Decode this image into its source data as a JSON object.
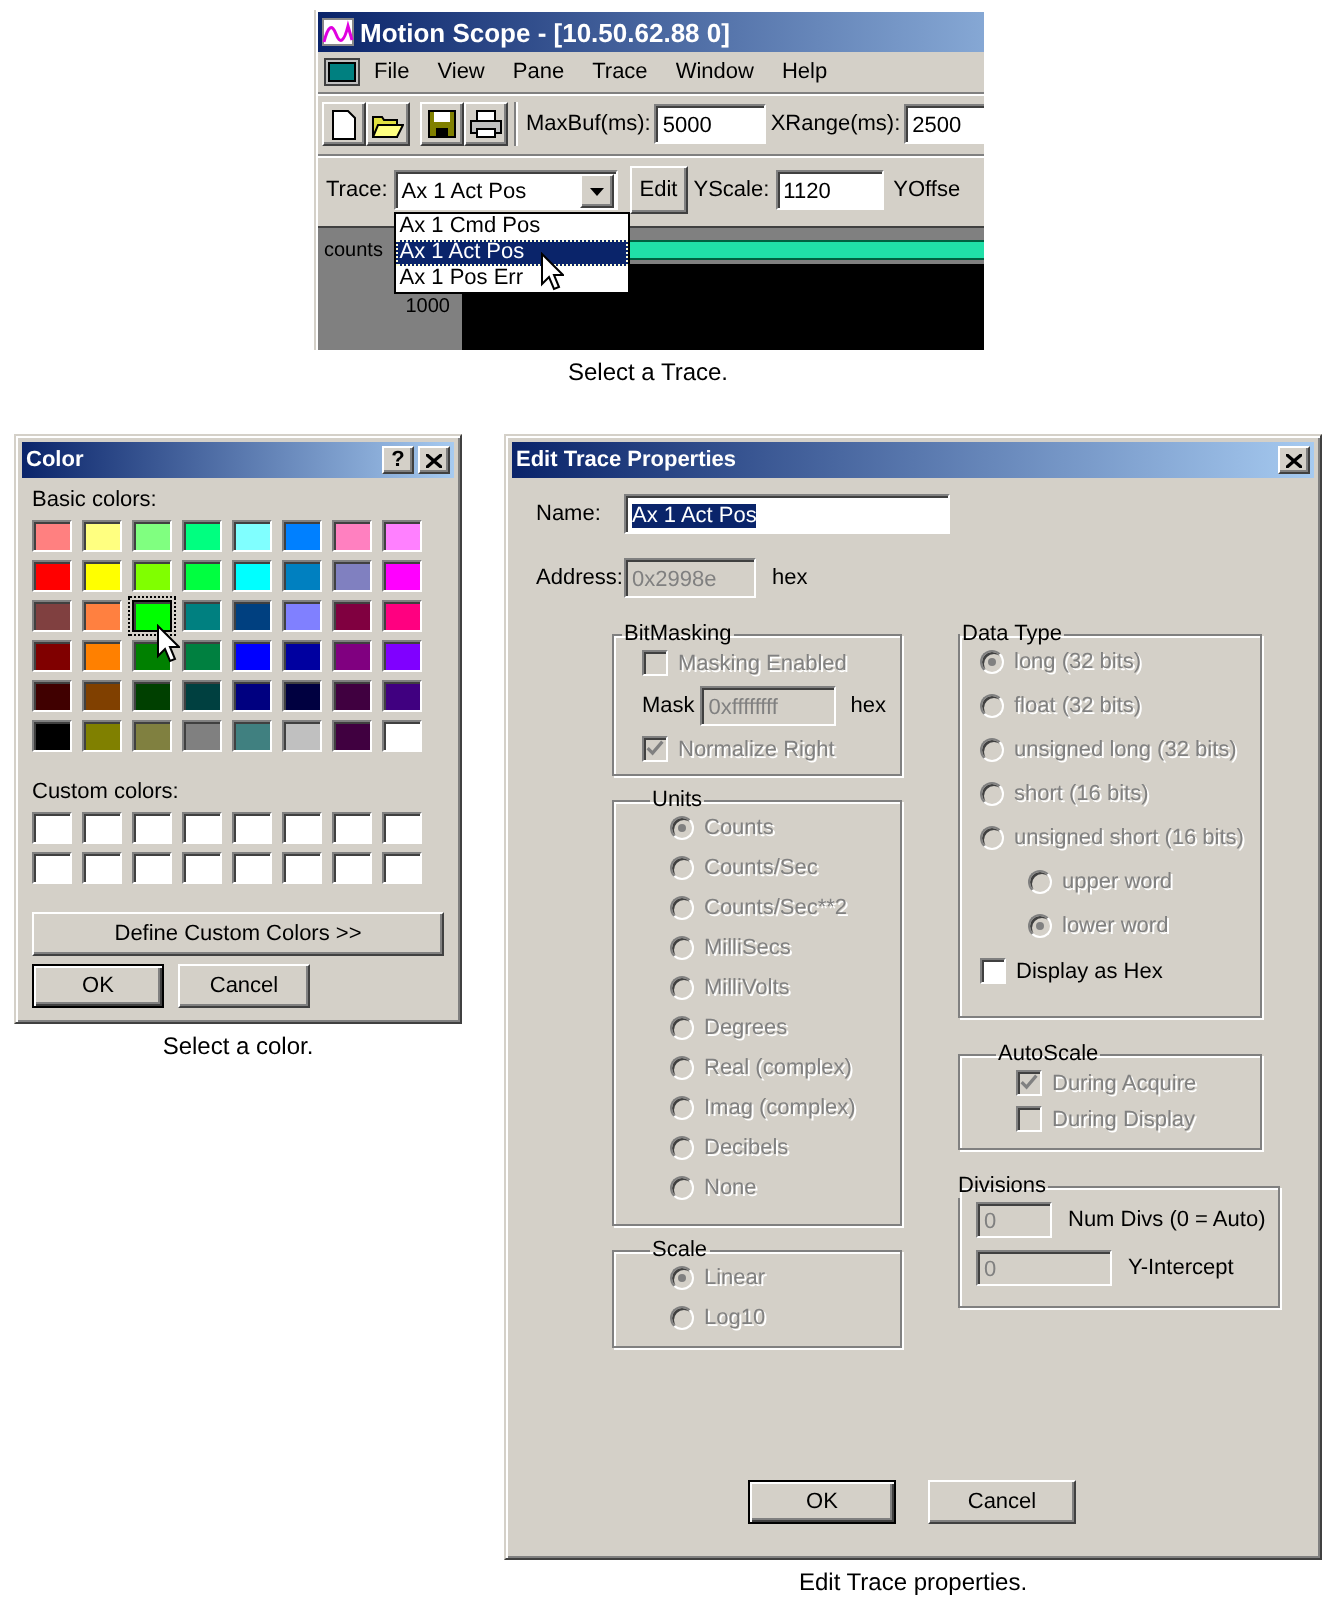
{
  "scope_window": {
    "title": "Motion Scope - [10.50.62.88 0]",
    "menu": [
      "File",
      "View",
      "Pane",
      "Trace",
      "Window",
      "Help"
    ],
    "toolbar_fields": [
      {
        "label": "MaxBuf(ms):",
        "value": "5000"
      },
      {
        "label": "XRange(ms):",
        "value": "2500"
      }
    ],
    "trace_label": "Trace:",
    "trace_value": "Ax 1 Act Pos",
    "expanded": true,
    "trace_options": [
      {
        "label": "Ax 1 Cmd Pos",
        "selected": false
      },
      {
        "label": "Ax 1 Act Pos",
        "selected": true
      },
      {
        "label": "Ax 1 Pos Err",
        "selected": false
      }
    ],
    "edit_button": "Edit",
    "yscale_label": "YScale:",
    "yscale_value": "1120",
    "yoffset_label": "YOffse",
    "plot": {
      "y_label": "counts",
      "y_tick": "1000"
    },
    "caption": "Select a Trace."
  },
  "color_dialog": {
    "title": "Color",
    "help_button": "?",
    "basic_label": "Basic colors:",
    "basic_colors": [
      {
        "color": "#ff8080",
        "selected": false
      },
      {
        "color": "#ffff80",
        "selected": false
      },
      {
        "color": "#80ff80",
        "selected": false
      },
      {
        "color": "#00ff80",
        "selected": false
      },
      {
        "color": "#80ffff",
        "selected": false
      },
      {
        "color": "#0080ff",
        "selected": false
      },
      {
        "color": "#ff80c0",
        "selected": false
      },
      {
        "color": "#ff80ff",
        "selected": false
      },
      {
        "color": "#ff0000",
        "selected": false
      },
      {
        "color": "#ffff00",
        "selected": false
      },
      {
        "color": "#80ff00",
        "selected": false
      },
      {
        "color": "#00ff40",
        "selected": false
      },
      {
        "color": "#00ffff",
        "selected": false
      },
      {
        "color": "#0080c0",
        "selected": false
      },
      {
        "color": "#8080c0",
        "selected": false
      },
      {
        "color": "#ff00ff",
        "selected": false
      },
      {
        "color": "#804040",
        "selected": false
      },
      {
        "color": "#ff8040",
        "selected": false
      },
      {
        "color": "#00ff00",
        "selected": true
      },
      {
        "color": "#008080",
        "selected": false
      },
      {
        "color": "#004080",
        "selected": false
      },
      {
        "color": "#8080ff",
        "selected": false
      },
      {
        "color": "#800040",
        "selected": false
      },
      {
        "color": "#ff0080",
        "selected": false
      },
      {
        "color": "#800000",
        "selected": false
      },
      {
        "color": "#ff8000",
        "selected": false
      },
      {
        "color": "#008000",
        "selected": false
      },
      {
        "color": "#008040",
        "selected": false
      },
      {
        "color": "#0000ff",
        "selected": false
      },
      {
        "color": "#0000a0",
        "selected": false
      },
      {
        "color": "#800080",
        "selected": false
      },
      {
        "color": "#8000ff",
        "selected": false
      },
      {
        "color": "#400000",
        "selected": false
      },
      {
        "color": "#804000",
        "selected": false
      },
      {
        "color": "#004000",
        "selected": false
      },
      {
        "color": "#004040",
        "selected": false
      },
      {
        "color": "#000080",
        "selected": false
      },
      {
        "color": "#000040",
        "selected": false
      },
      {
        "color": "#400040",
        "selected": false
      },
      {
        "color": "#400080",
        "selected": false
      },
      {
        "color": "#000000",
        "selected": false
      },
      {
        "color": "#808000",
        "selected": false
      },
      {
        "color": "#808040",
        "selected": false
      },
      {
        "color": "#808080",
        "selected": false
      },
      {
        "color": "#408080",
        "selected": false
      },
      {
        "color": "#c0c0c0",
        "selected": false
      },
      {
        "color": "#400040",
        "selected": false
      },
      {
        "color": "#ffffff",
        "selected": false
      }
    ],
    "custom_label": "Custom colors:",
    "define_button": "Define Custom Colors >>",
    "buttons": [
      {
        "label": "OK",
        "default": true
      },
      {
        "label": "Cancel",
        "default": false
      }
    ],
    "caption": "Select a color."
  },
  "edit_dialog": {
    "title": "Edit Trace Properties",
    "name_label": "Name:",
    "name_value": "Ax 1 Act Pos",
    "name_highlighted": true,
    "address_label": "Address:",
    "address_value": "0x2998e",
    "address_disabled": true,
    "address_unit": "hex",
    "bitmasking": {
      "title": "BitMasking",
      "masking": {
        "label": "Masking Enabled",
        "checked": false,
        "disabled": true
      },
      "mask_label": "Mask",
      "mask_value": "0xffffffff",
      "mask_disabled": true,
      "mask_unit": "hex",
      "normalize": {
        "label": "Normalize Right",
        "checked": true,
        "disabled": true
      }
    },
    "units": {
      "title": "Units",
      "options": [
        {
          "label": "Counts",
          "selected": true,
          "disabled": true
        },
        {
          "label": "Counts/Sec",
          "selected": false,
          "disabled": true
        },
        {
          "label": "Counts/Sec**2",
          "selected": false,
          "disabled": true
        },
        {
          "label": "MilliSecs",
          "selected": false,
          "disabled": true
        },
        {
          "label": "MilliVolts",
          "selected": false,
          "disabled": true
        },
        {
          "label": "Degrees",
          "selected": false,
          "disabled": true
        },
        {
          "label": "Real (complex)",
          "selected": false,
          "disabled": true
        },
        {
          "label": "Imag (complex)",
          "selected": false,
          "disabled": true
        },
        {
          "label": "Decibels",
          "selected": false,
          "disabled": true
        },
        {
          "label": "None",
          "selected": false,
          "disabled": true
        }
      ]
    },
    "scale": {
      "title": "Scale",
      "options": [
        {
          "label": "Linear",
          "selected": true,
          "disabled": true
        },
        {
          "label": "Log10",
          "selected": false,
          "disabled": true
        }
      ]
    },
    "data_type": {
      "title": "Data Type",
      "options": [
        {
          "label": "long (32 bits)",
          "selected": true,
          "disabled": true
        },
        {
          "label": "float (32 bits)",
          "selected": false,
          "disabled": true
        },
        {
          "label": "unsigned long (32 bits)",
          "selected": false,
          "disabled": true
        },
        {
          "label": "short (16 bits)",
          "selected": false,
          "disabled": true
        },
        {
          "label": "unsigned short (16 bits)",
          "selected": false,
          "disabled": true,
          "children": [
            {
              "label": "upper word",
              "selected": false,
              "disabled": true
            },
            {
              "label": "lower word",
              "selected": true,
              "disabled": true
            }
          ]
        }
      ],
      "hex": {
        "label": "Display as Hex",
        "checked": false,
        "disabled": false
      }
    },
    "autoscale": {
      "title": "AutoScale",
      "options": [
        {
          "label": "During Acquire",
          "checked": true,
          "disabled": true
        },
        {
          "label": "During Display",
          "checked": false,
          "disabled": true
        }
      ]
    },
    "divisions": {
      "title": "Divisions",
      "fields": [
        {
          "label": "Num Divs (0 = Auto)",
          "value": "0",
          "disabled": true
        },
        {
          "label": "Y-Intercept",
          "value": "0",
          "disabled": true
        }
      ]
    },
    "buttons": [
      {
        "label": "OK",
        "default": true
      },
      {
        "label": "Cancel",
        "default": false
      }
    ],
    "caption": "Edit Trace properties."
  }
}
